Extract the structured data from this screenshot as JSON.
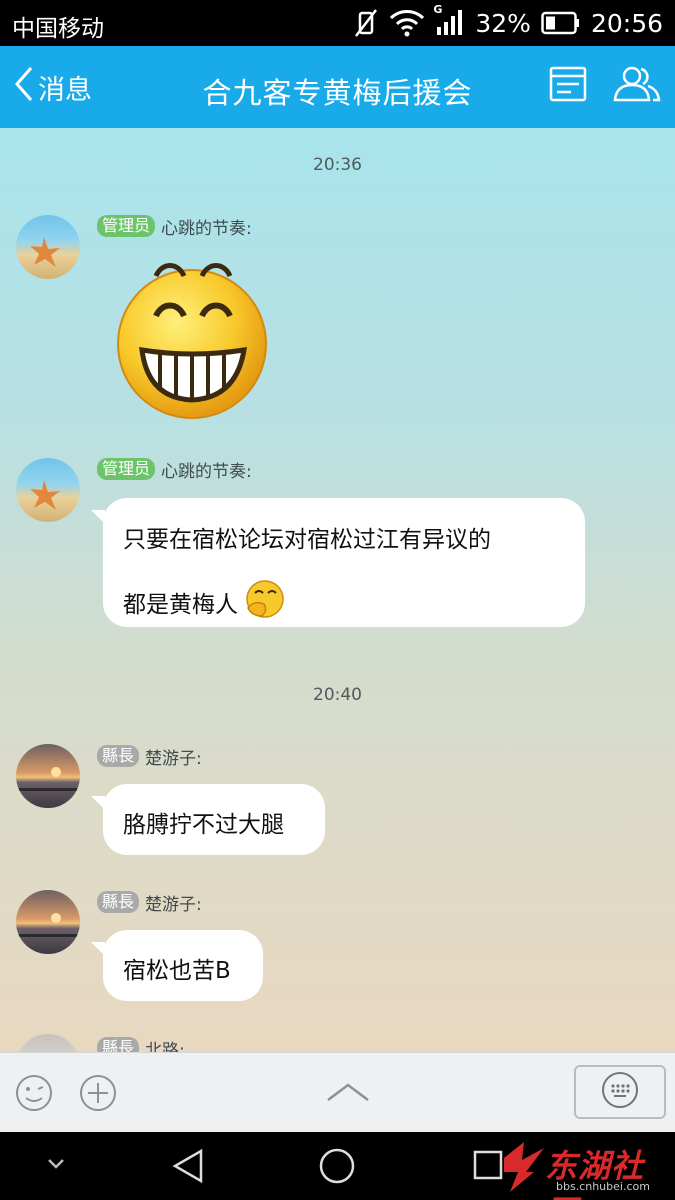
{
  "status_bar": {
    "carrier": "中国移动",
    "network": "G",
    "battery": "32%",
    "time": "20:56",
    "icons": [
      "vibrate-icon",
      "wifi-icon",
      "signal-icon",
      "battery-icon"
    ]
  },
  "title_bar": {
    "back_label": "消息",
    "title": "合九客专黄梅后援会",
    "icons": [
      "group-info-icon",
      "members-icon"
    ],
    "color": "#19aaea"
  },
  "chat": {
    "timestamps": [
      "20:36",
      "20:40"
    ],
    "messages": [
      {
        "badge": "管理员",
        "sender": "心跳的节奏:",
        "type": "sticker",
        "sticker": "grinning-face-sticker"
      },
      {
        "badge": "管理员",
        "sender": "心跳的节奏:",
        "type": "text",
        "line1": "只要在宿松论坛对宿松过江有异议的",
        "line2": "都是黄梅人",
        "emoji": "thinking-face-emoji"
      },
      {
        "badge": "縣長",
        "sender": "楚游子:",
        "type": "text",
        "text": "胳膊拧不过大腿"
      },
      {
        "badge": "縣長",
        "sender": "楚游子:",
        "type": "text",
        "text": "宿松也苦B"
      },
      {
        "badge": "縣長",
        "sender": "北路:",
        "type": "text"
      }
    ],
    "badge_colors": {
      "admin": "#6cc46a",
      "rank": "#a9a9a9"
    }
  },
  "input_bar": {
    "icons": [
      "emoji-icon",
      "plus-icon",
      "expand-up-icon",
      "keyboard-icon"
    ]
  },
  "nav_bar": {
    "icons": [
      "chevron-down-icon",
      "back-triangle-icon",
      "home-circle-icon",
      "recents-square-icon"
    ],
    "watermark_text": "东湖社区",
    "watermark_url": "bbs.cnhubei.com"
  }
}
